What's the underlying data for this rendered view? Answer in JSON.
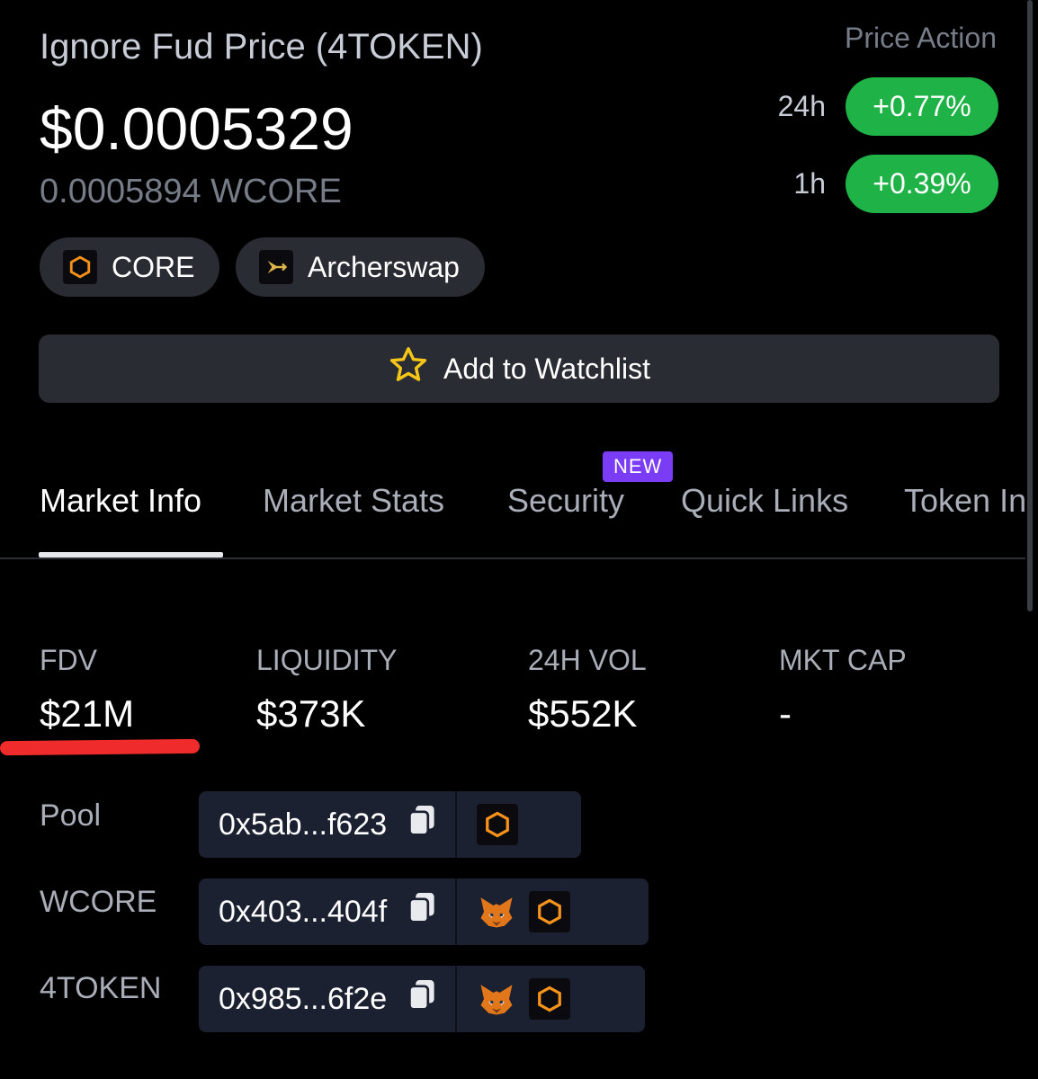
{
  "header": {
    "title": "Ignore Fud Price (4TOKEN)",
    "price_usd": "$0.0005329",
    "price_wcore": "0.0005894 WCORE"
  },
  "price_action": {
    "label": "Price Action",
    "rows": [
      {
        "period": "24h",
        "change": "+0.77%"
      },
      {
        "period": "1h",
        "change": "+0.39%"
      }
    ]
  },
  "chips": [
    {
      "label": "CORE",
      "icon": "core-hexagon-icon"
    },
    {
      "label": "Archerswap",
      "icon": "archerswap-icon"
    }
  ],
  "watchlist": {
    "label": "Add to Watchlist",
    "icon": "star-icon"
  },
  "tabs": {
    "items": [
      "Market Info",
      "Market Stats",
      "Security",
      "Quick Links",
      "Token In"
    ],
    "active": "Market Info",
    "new_badge": "NEW"
  },
  "stats": [
    {
      "label": "FDV",
      "value": "$21M"
    },
    {
      "label": "LIQUIDITY",
      "value": "$373K"
    },
    {
      "label": "24H VOL",
      "value": "$552K"
    },
    {
      "label": "MKT CAP",
      "value": "-"
    }
  ],
  "addresses": [
    {
      "label": "Pool",
      "address": "0x5ab...f623",
      "icons": [
        "core-hexagon-icon"
      ]
    },
    {
      "label": "WCORE",
      "address": "0x403...404f",
      "icons": [
        "metamask-fox-icon",
        "core-hexagon-icon"
      ]
    },
    {
      "label": "4TOKEN",
      "address": "0x985...6f2e",
      "icons": [
        "metamask-fox-icon",
        "core-hexagon-icon"
      ]
    }
  ],
  "colors": {
    "background": "#000000",
    "positive": "#1fb347",
    "accent_new": "#7a3cf5",
    "highlight_underline": "#ef2b2b",
    "core_orange": "#f7931a"
  }
}
